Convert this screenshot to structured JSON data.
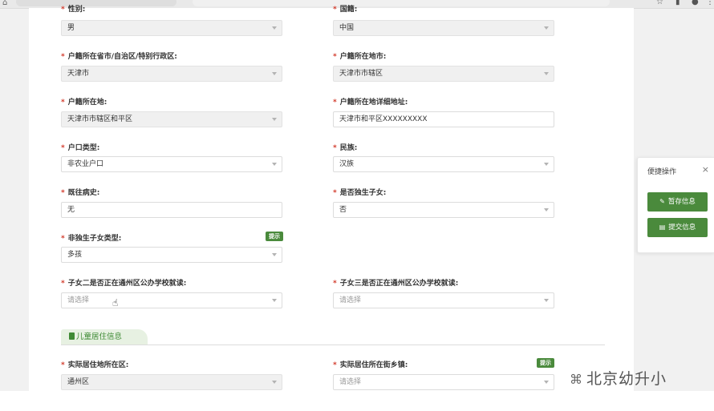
{
  "browser": {
    "back_glyph": "⌂",
    "icons": [
      "star-icon",
      "extensions-icon",
      "profile-icon",
      "menu-icon"
    ]
  },
  "form": {
    "rows": [
      {
        "left": {
          "label": "性别:",
          "required": true,
          "value": "男",
          "type": "select"
        },
        "right": {
          "label": "国籍:",
          "required": true,
          "value": "中国",
          "type": "select"
        }
      },
      {
        "left": {
          "label": "户籍所在省市/自治区/特别行政区:",
          "required": true,
          "value": "天津市",
          "type": "select"
        },
        "right": {
          "label": "户籍所在地市:",
          "required": true,
          "value": "天津市市辖区",
          "type": "select"
        }
      },
      {
        "left": {
          "label": "户籍所在地:",
          "required": true,
          "value": "天津市市辖区和平区",
          "type": "select"
        },
        "right": {
          "label": "户籍所在地详细地址:",
          "required": true,
          "value": "天津市和平区XXXXXXXXX",
          "type": "input"
        }
      },
      {
        "left": {
          "label": "户口类型:",
          "required": true,
          "value": "非农业户口",
          "type": "select"
        },
        "right": {
          "label": "民族:",
          "required": true,
          "value": "汉族",
          "type": "select"
        }
      },
      {
        "left": {
          "label": "既往病史:",
          "required": true,
          "value": "无",
          "type": "input"
        },
        "right": {
          "label": "是否独生子女:",
          "required": true,
          "value": "否",
          "type": "select"
        }
      },
      {
        "left": {
          "label": "非独生子女类型:",
          "required": true,
          "value": "多孩",
          "type": "select",
          "badge": "提示"
        }
      },
      {
        "left": {
          "label": "子女二是否正在通州区公办学校就读:",
          "required": true,
          "placeholder": "请选择",
          "type": "select"
        },
        "right": {
          "label": "子女三是否正在通州区公办学校就读:",
          "required": true,
          "placeholder": "请选择",
          "type": "select"
        }
      }
    ],
    "section_title": "儿童居住信息",
    "section_rows": [
      {
        "left": {
          "label": "实际居住地所在区:",
          "required": true,
          "value": "通州区",
          "type": "select"
        },
        "right": {
          "label": "实际居住所在街乡镇:",
          "required": true,
          "placeholder": "请选择",
          "type": "select",
          "badge": "提示"
        }
      }
    ]
  },
  "quick_panel": {
    "title": "便捷操作",
    "close_glyph": "×",
    "save_label": "暂存信息",
    "submit_label": "提交信息"
  },
  "watermark": {
    "text": "北京幼升小"
  },
  "colors": {
    "accent_green": "#4a8a3c",
    "required_red": "#d23a2b"
  }
}
